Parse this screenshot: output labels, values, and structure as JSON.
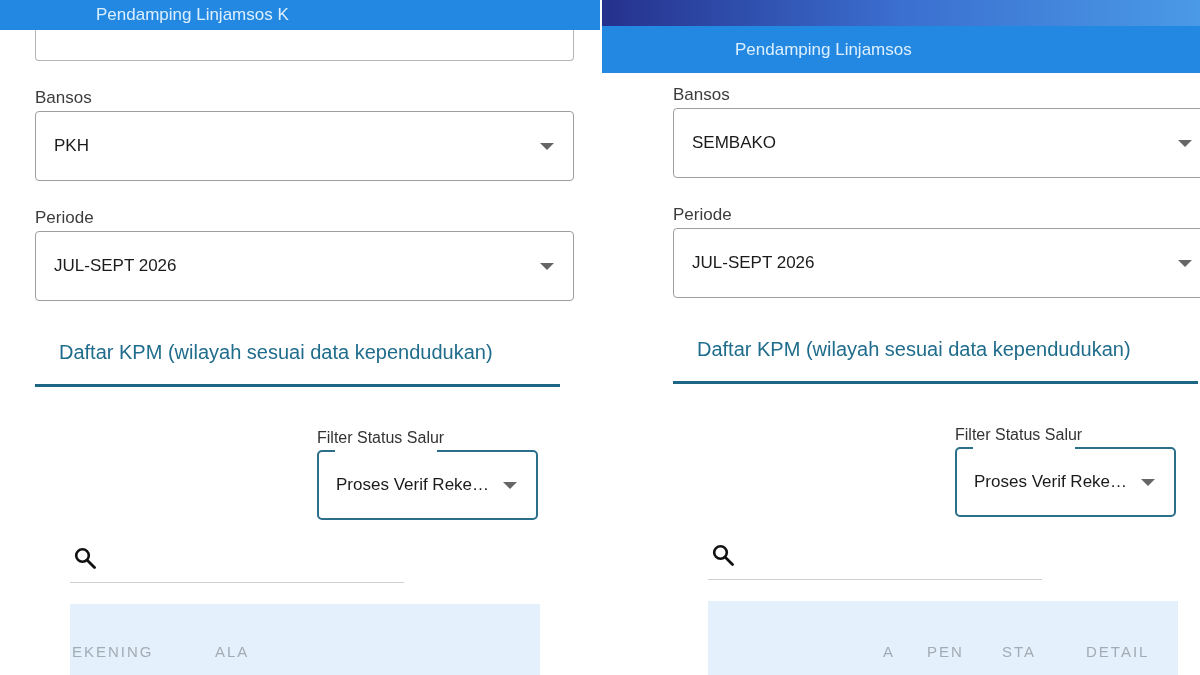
{
  "panels": [
    {
      "app_bar": {
        "title": "Pendamping Linjamsos K"
      },
      "fields": [
        {
          "label": "Bansos",
          "value": "PKH"
        },
        {
          "label": "Periode",
          "value": "JUL-SEPT 2026"
        }
      ],
      "tab": {
        "label": "Daftar KPM (wilayah sesuai data kependudukan)",
        "selected": true
      },
      "filter": {
        "label": "Filter Status Salur",
        "value": "Proses Verif Reke…"
      },
      "table": {
        "columns": [
          "EKENING",
          "ALA"
        ]
      }
    },
    {
      "app_bar": {
        "title": "Pendamping Linjamsos"
      },
      "fields": [
        {
          "label": "Bansos",
          "value": "SEMBAKO"
        },
        {
          "label": "Periode",
          "value": "JUL-SEPT 2026"
        }
      ],
      "tab": {
        "label": "Daftar KPM (wilayah sesuai data kependudukan)",
        "selected": true
      },
      "filter": {
        "label": "Filter Status Salur",
        "value": "Proses Verif Reke…"
      },
      "table": {
        "columns": [
          "A",
          "PEN",
          "STA",
          "DETAIL"
        ]
      }
    }
  ]
}
